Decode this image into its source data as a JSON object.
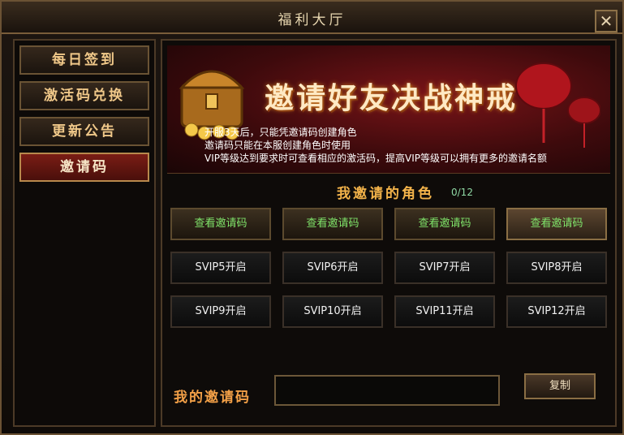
{
  "window": {
    "title": "福利大厅",
    "close_icon": "close-icon"
  },
  "sidebar": {
    "tabs": [
      {
        "label": "每日签到",
        "active": false
      },
      {
        "label": "激活码兑换",
        "active": false
      },
      {
        "label": "更新公告",
        "active": false
      },
      {
        "label": "邀请码",
        "active": true
      }
    ]
  },
  "banner": {
    "title": "邀请好友决战神戒",
    "rules": [
      "开服3天后，只能凭邀请码创建角色",
      "邀请码只能在本服创建角色时使用",
      "VIP等级达到要求时可查看相应的激活码，提高VIP等级可以拥有更多的邀请名额"
    ]
  },
  "invited": {
    "title": "我邀请的角色",
    "count": "0/12",
    "slots": [
      {
        "label": "查看邀请码",
        "type": "view"
      },
      {
        "label": "查看邀请码",
        "type": "view"
      },
      {
        "label": "查看邀请码",
        "type": "view"
      },
      {
        "label": "查看邀请码",
        "type": "view"
      },
      {
        "label": "SVIP5开启",
        "type": "vip"
      },
      {
        "label": "SVIP6开启",
        "type": "vip"
      },
      {
        "label": "SVIP7开启",
        "type": "vip"
      },
      {
        "label": "SVIP8开启",
        "type": "vip"
      },
      {
        "label": "SVIP9开启",
        "type": "vip"
      },
      {
        "label": "SVIP10开启",
        "type": "vip"
      },
      {
        "label": "SVIP11开启",
        "type": "vip"
      },
      {
        "label": "SVIP12开启",
        "type": "vip"
      }
    ]
  },
  "my_code": {
    "label": "我的邀请码",
    "value": "",
    "copy_label": "复制"
  },
  "colors": {
    "gold": "#f3b34a",
    "green": "#7fe36a",
    "banner_red": "#7a1418"
  }
}
